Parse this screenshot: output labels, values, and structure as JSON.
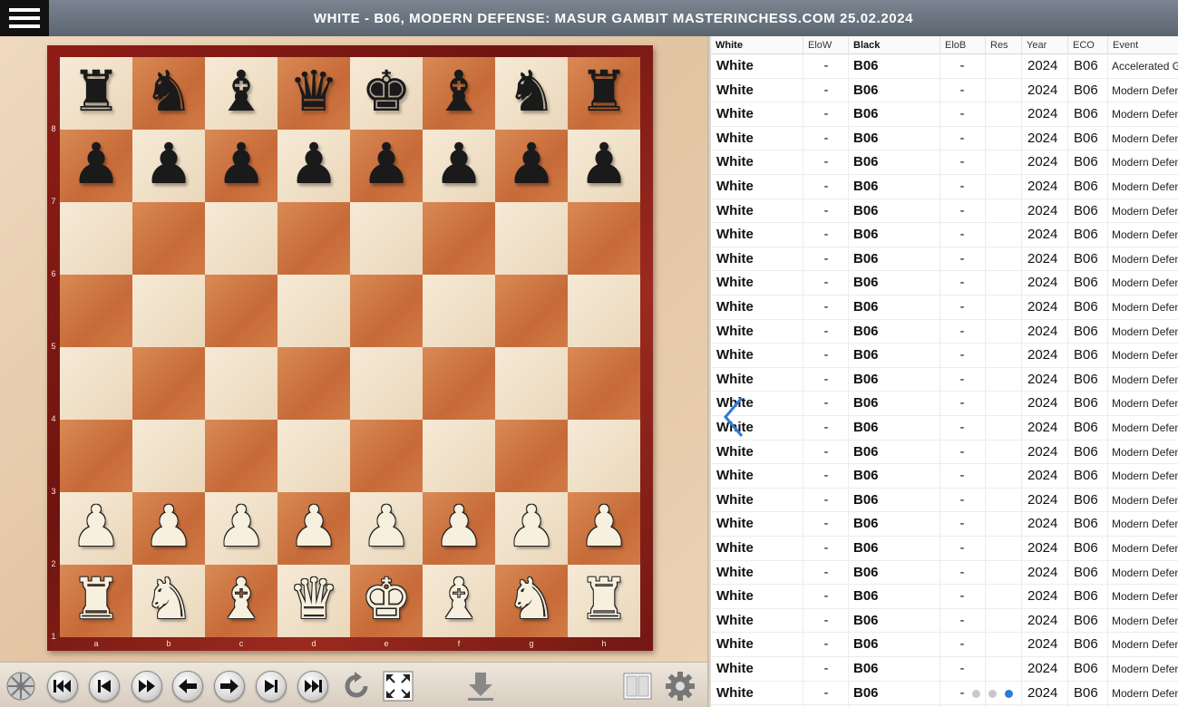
{
  "header": {
    "title": "WHITE - B06, MODERN DEFENSE: MASUR GAMBIT MASTERINCHESS.COM 25.02.2024"
  },
  "board": {
    "ranks": [
      "8",
      "7",
      "6",
      "5",
      "4",
      "3",
      "2",
      "1"
    ],
    "files": [
      "a",
      "b",
      "c",
      "d",
      "e",
      "f",
      "g",
      "h"
    ],
    "position": [
      [
        "♜",
        "♞",
        "♝",
        "♛",
        "♚",
        "♝",
        "♞",
        "♜"
      ],
      [
        "♟",
        "♟",
        "♟",
        "♟",
        "♟",
        "♟",
        "♟",
        "♟"
      ],
      [
        "",
        "",
        "",
        "",
        "",
        "",
        "",
        ""
      ],
      [
        "",
        "",
        "",
        "",
        "",
        "",
        "",
        ""
      ],
      [
        "",
        "",
        "",
        "",
        "",
        "",
        "",
        ""
      ],
      [
        "",
        "",
        "",
        "",
        "",
        "",
        "",
        ""
      ],
      [
        "♟",
        "♟",
        "♟",
        "♟",
        "♟",
        "♟",
        "♟",
        "♟"
      ],
      [
        "♜",
        "♞",
        "♝",
        "♛",
        "♚",
        "♝",
        "♞",
        "♜"
      ]
    ],
    "colors": {
      "light": "#f2e4cc",
      "dark": "#cf7543",
      "frame": "#7e1913"
    }
  },
  "toolbar": {
    "buttons": [
      {
        "name": "wheel-icon"
      },
      {
        "name": "first-move-icon"
      },
      {
        "name": "previous-move-icon"
      },
      {
        "name": "play-icon"
      },
      {
        "name": "back-arrow-icon"
      },
      {
        "name": "forward-arrow-icon"
      },
      {
        "name": "next-move-icon"
      },
      {
        "name": "last-move-icon"
      },
      {
        "name": "rotate-board-icon"
      },
      {
        "name": "fullscreen-icon"
      },
      {
        "name": "download-icon"
      },
      {
        "name": "book-icon"
      },
      {
        "name": "settings-gear-icon"
      }
    ]
  },
  "games_list": {
    "columns": [
      "White",
      "EloW",
      "Black",
      "EloB",
      "Res",
      "Year",
      "ECO",
      "Event"
    ],
    "rows": [
      [
        "White",
        "-",
        "B06",
        "-",
        "",
        "2024",
        "B06",
        "Accelerated G"
      ],
      [
        "White",
        "-",
        "B06",
        "-",
        "",
        "2024",
        "B06",
        "Modern Defen"
      ],
      [
        "White",
        "-",
        "B06",
        "-",
        "",
        "2024",
        "B06",
        "Modern Defen"
      ],
      [
        "White",
        "-",
        "B06",
        "-",
        "",
        "2024",
        "B06",
        "Modern Defen"
      ],
      [
        "White",
        "-",
        "B06",
        "-",
        "",
        "2024",
        "B06",
        "Modern Defen"
      ],
      [
        "White",
        "-",
        "B06",
        "-",
        "",
        "2024",
        "B06",
        "Modern Defen"
      ],
      [
        "White",
        "-",
        "B06",
        "-",
        "",
        "2024",
        "B06",
        "Modern Defen"
      ],
      [
        "White",
        "-",
        "B06",
        "-",
        "",
        "2024",
        "B06",
        "Modern Defen"
      ],
      [
        "White",
        "-",
        "B06",
        "-",
        "",
        "2024",
        "B06",
        "Modern Defen"
      ],
      [
        "White",
        "-",
        "B06",
        "-",
        "",
        "2024",
        "B06",
        "Modern Defen"
      ],
      [
        "White",
        "-",
        "B06",
        "-",
        "",
        "2024",
        "B06",
        "Modern Defen"
      ],
      [
        "White",
        "-",
        "B06",
        "-",
        "",
        "2024",
        "B06",
        "Modern Defen"
      ],
      [
        "White",
        "-",
        "B06",
        "-",
        "",
        "2024",
        "B06",
        "Modern Defen"
      ],
      [
        "White",
        "-",
        "B06",
        "-",
        "",
        "2024",
        "B06",
        "Modern Defen"
      ],
      [
        "White",
        "-",
        "B06",
        "-",
        "",
        "2024",
        "B06",
        "Modern Defen"
      ],
      [
        "White",
        "-",
        "B06",
        "-",
        "",
        "2024",
        "B06",
        "Modern Defen"
      ],
      [
        "White",
        "-",
        "B06",
        "-",
        "",
        "2024",
        "B06",
        "Modern Defen"
      ],
      [
        "White",
        "-",
        "B06",
        "-",
        "",
        "2024",
        "B06",
        "Modern Defen"
      ],
      [
        "White",
        "-",
        "B06",
        "-",
        "",
        "2024",
        "B06",
        "Modern Defen"
      ],
      [
        "White",
        "-",
        "B06",
        "-",
        "",
        "2024",
        "B06",
        "Modern Defen"
      ],
      [
        "White",
        "-",
        "B06",
        "-",
        "",
        "2024",
        "B06",
        "Modern Defen"
      ],
      [
        "White",
        "-",
        "B06",
        "-",
        "",
        "2024",
        "B06",
        "Modern Defen"
      ],
      [
        "White",
        "-",
        "B06",
        "-",
        "",
        "2024",
        "B06",
        "Modern Defen"
      ],
      [
        "White",
        "-",
        "B06",
        "-",
        "",
        "2024",
        "B06",
        "Modern Defen"
      ],
      [
        "White",
        "-",
        "B06",
        "-",
        "",
        "2024",
        "B06",
        "Modern Defen"
      ],
      [
        "White",
        "-",
        "B06",
        "-",
        "",
        "2024",
        "B06",
        "Modern Defen"
      ],
      [
        "White",
        "-",
        "B06",
        "-",
        "",
        "2024",
        "B06",
        "Modern Defen"
      ]
    ],
    "pager": {
      "pages": 3,
      "active": 2
    },
    "accent": "#2e7bd6"
  }
}
